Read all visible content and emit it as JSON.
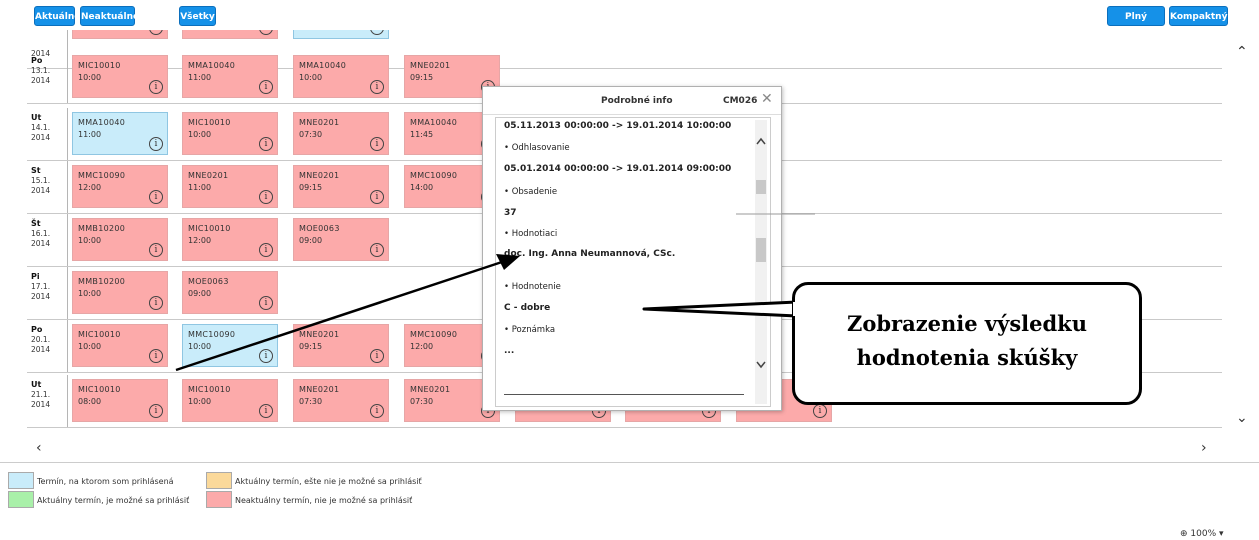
{
  "toolbar": {
    "aktualne": "Aktuálne",
    "neaktualne": "Neaktuálne",
    "vsetky": "Všetky",
    "plny": "Plný",
    "kompaktny": "Kompaktný"
  },
  "rows": [
    {
      "day": "",
      "date": "",
      "year": "2014",
      "exams": []
    },
    {
      "day": "Po",
      "date": "13.1.",
      "year": "2014",
      "exams": [
        {
          "code": "MIC10010",
          "time": "10:00",
          "status": "pink"
        },
        {
          "code": "MMA10040",
          "time": "11:00",
          "status": "pink"
        },
        {
          "code": "MMA10040",
          "time": "10:00",
          "status": "pink"
        },
        {
          "code": "MNE0201",
          "time": "09:15",
          "status": "pink"
        }
      ]
    },
    {
      "day": "Ut",
      "date": "14.1.",
      "year": "2014",
      "exams": [
        {
          "code": "MMA10040",
          "time": "11:00",
          "status": "blue"
        },
        {
          "code": "MIC10010",
          "time": "10:00",
          "status": "pink"
        },
        {
          "code": "MNE0201",
          "time": "07:30",
          "status": "pink"
        },
        {
          "code": "MMA10040",
          "time": "11:45",
          "status": "pink"
        }
      ]
    },
    {
      "day": "St",
      "date": "15.1.",
      "year": "2014",
      "exams": [
        {
          "code": "MMC10090",
          "time": "12:00",
          "status": "pink"
        },
        {
          "code": "MNE0201",
          "time": "11:00",
          "status": "pink"
        },
        {
          "code": "MNE0201",
          "time": "09:15",
          "status": "pink"
        },
        {
          "code": "MMC10090",
          "time": "14:00",
          "status": "pink"
        }
      ]
    },
    {
      "day": "Št",
      "date": "16.1.",
      "year": "2014",
      "exams": [
        {
          "code": "MMB10200",
          "time": "10:00",
          "status": "pink"
        },
        {
          "code": "MIC10010",
          "time": "12:00",
          "status": "pink"
        },
        {
          "code": "MOE0063",
          "time": "09:00",
          "status": "pink"
        }
      ]
    },
    {
      "day": "Pi",
      "date": "17.1.",
      "year": "2014",
      "exams": [
        {
          "code": "MMB10200",
          "time": "10:00",
          "status": "pink"
        },
        {
          "code": "MOE0063",
          "time": "09:00",
          "status": "pink"
        }
      ]
    },
    {
      "day": "Po",
      "date": "20.1.",
      "year": "2014",
      "exams": [
        {
          "code": "MIC10010",
          "time": "10:00",
          "status": "pink"
        },
        {
          "code": "MMC10090",
          "time": "10:00",
          "status": "blue"
        },
        {
          "code": "MNE0201",
          "time": "09:15",
          "status": "pink"
        },
        {
          "code": "MMC10090",
          "time": "12:00",
          "status": "pink"
        }
      ]
    },
    {
      "day": "Ut",
      "date": "21.1.",
      "year": "2014",
      "exams": [
        {
          "code": "MIC10010",
          "time": "08:00",
          "status": "pink"
        },
        {
          "code": "MIC10010",
          "time": "10:00",
          "status": "pink"
        },
        {
          "code": "MNE0201",
          "time": "07:30",
          "status": "pink"
        },
        {
          "code": "MNE0201",
          "time": "07:30",
          "status": "pink"
        }
      ]
    }
  ],
  "popup": {
    "title": "Podrobné info",
    "code": "CM026",
    "lines": [
      {
        "text": "05.11.2013 00:00:00 -> 19.01.2014 10:00:00",
        "bold": true
      },
      {
        "text": "•  Odhlasovanie",
        "bold": false
      },
      {
        "text": "05.01.2014 00:00:00 -> 19.01.2014 09:00:00",
        "bold": true
      },
      {
        "text": "•  Obsadenie",
        "bold": false
      },
      {
        "text": "37",
        "bold": true
      },
      {
        "text": "•  Hodnotiaci",
        "bold": false
      },
      {
        "text": "doc. Ing. Anna Neumannová, CSc.",
        "bold": true
      },
      {
        "text": "•  Hodnotenie",
        "bold": false
      },
      {
        "text": "C - dobre",
        "bold": true
      },
      {
        "text": "•  Poznámka",
        "bold": false
      },
      {
        "text": "...",
        "bold": true
      }
    ]
  },
  "callout": {
    "line1": "Zobrazenie výsledku",
    "line2": "hodnotenia skúšky"
  },
  "legend": [
    {
      "label": "Termín, na ktorom som prihlásená",
      "color": "#c9ecfa"
    },
    {
      "label": "Aktuálny termín, ešte nie je možné sa prihlásiť",
      "color": "#fbd99a"
    },
    {
      "label": "Aktuálny termín, je možné sa prihlásiť",
      "color": "#a9f0a9"
    },
    {
      "label": "Neaktuálny termín, nie je možné sa prihlásiť",
      "color": "#fcaaaa"
    }
  ],
  "zoom": "100%"
}
